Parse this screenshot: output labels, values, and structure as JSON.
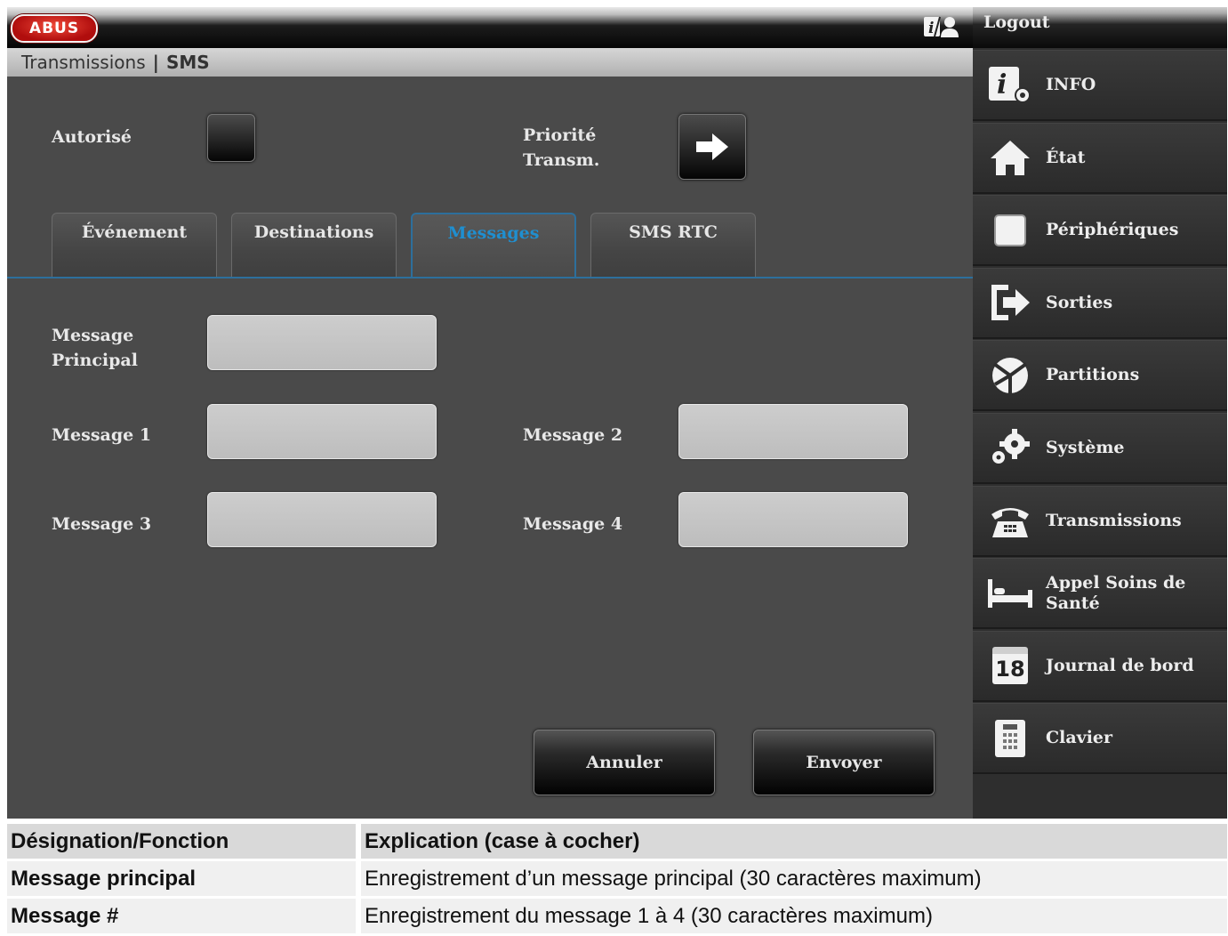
{
  "header": {
    "logo_text": "ABUS",
    "breadcrumb": {
      "section": "Transmissions",
      "separator": "|",
      "current": "SMS"
    },
    "help_icon": "help-user-icon",
    "logout_label": "Logout"
  },
  "controls": {
    "autorise_label": "Autorisé",
    "priorite_label_line1": "Priorité",
    "priorite_label_line2": "Transm."
  },
  "tabs": [
    {
      "label": "Événement"
    },
    {
      "label": "Destinations"
    },
    {
      "label": "Messages",
      "active": true
    },
    {
      "label": "SMS RTC"
    }
  ],
  "form": {
    "message_principal_line1": "Message",
    "message_principal_line2": "Principal",
    "message1_label": "Message 1",
    "message2_label": "Message 2",
    "message3_label": "Message 3",
    "message4_label": "Message 4",
    "values": {
      "principal": "",
      "m1": "",
      "m2": "",
      "m3": "",
      "m4": ""
    }
  },
  "actions": {
    "cancel_label": "Annuler",
    "send_label": "Envoyer"
  },
  "sidebar": {
    "items": [
      {
        "label": "INFO",
        "icon": "info-gear-icon"
      },
      {
        "label": "État",
        "icon": "home-icon"
      },
      {
        "label": "Périphériques",
        "icon": "square-icon"
      },
      {
        "label": "Sorties",
        "icon": "exit-arrow-icon"
      },
      {
        "label": "Partitions",
        "icon": "pie-partition-icon"
      },
      {
        "label": "Système",
        "icon": "gears-icon"
      },
      {
        "label": "Transmissions",
        "icon": "telephone-icon"
      },
      {
        "label_line1": "Appel Soins de",
        "label_line2": "Santé",
        "icon": "bed-icon"
      },
      {
        "label": "Journal de bord",
        "icon": "calendar-icon",
        "calendar_day": "18"
      },
      {
        "label": "Clavier",
        "icon": "keypad-icon"
      }
    ]
  },
  "doc_table": {
    "header": {
      "col1": "Désignation/Fonction",
      "col2": "Explication (case à cocher)"
    },
    "rows": [
      {
        "col1": "Message principal",
        "col2": "Enregistrement d’un message principal (30 caractères maximum)"
      },
      {
        "col1": "Message #",
        "col2": "Enregistrement du message 1 à 4 (30 caractères maximum)"
      }
    ]
  }
}
